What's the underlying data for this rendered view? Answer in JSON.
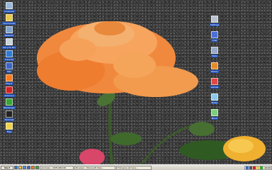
{
  "desktop": {
    "left_icons": [
      {
        "label": "Computer",
        "icon": "computer-icon",
        "color": "#9bb8d8"
      },
      {
        "label": "Documents",
        "icon": "folder-icon",
        "color": "#e9c94a"
      },
      {
        "label": "Network",
        "icon": "network-icon",
        "color": "#7fa3cf"
      },
      {
        "label": "Recycle Bin",
        "icon": "recycle-bin-icon",
        "color": "#c9d3da"
      },
      {
        "label": "Internet",
        "icon": "internet-icon",
        "color": "#2f7bd4"
      },
      {
        "label": "Mail",
        "icon": "mail-icon",
        "color": "#3b66c4"
      },
      {
        "label": "Player",
        "icon": "media-player-icon",
        "color": "#ff7a1a"
      },
      {
        "label": "Antivirus",
        "icon": "shield-icon",
        "color": "#d42020"
      },
      {
        "label": "Messenger",
        "icon": "messenger-icon",
        "color": "#36a536"
      },
      {
        "label": "Terminal",
        "icon": "terminal-icon",
        "color": "#232323"
      },
      {
        "label": "Files",
        "icon": "folder-icon",
        "color": "#f0d24a"
      }
    ],
    "right_icons": [
      {
        "label": "Settings",
        "icon": "gear-icon",
        "color": "#b9c3cf"
      },
      {
        "label": "Chat",
        "icon": "chat-icon",
        "color": "#4c6fd6"
      },
      {
        "label": "Tools",
        "icon": "tools-icon",
        "color": "#9aa9c6"
      },
      {
        "label": "Photos",
        "icon": "photo-icon",
        "color": "#e38b2b"
      },
      {
        "label": "Games",
        "icon": "game-icon",
        "color": "#e04848"
      },
      {
        "label": "Notes",
        "icon": "notes-icon",
        "color": "#8ec6e9"
      },
      {
        "label": "Music",
        "icon": "music-icon",
        "color": "#7ccf7c"
      }
    ]
  },
  "taskbar": {
    "start_label": "Start",
    "quick_launch": [
      {
        "icon": "browser-icon",
        "color": "#2f7bd4"
      },
      {
        "icon": "folder-icon",
        "color": "#e9c94a"
      },
      {
        "icon": "desktop-icon",
        "color": "#5a8bd6"
      },
      {
        "icon": "mail-icon",
        "color": "#3b66c4"
      },
      {
        "icon": "media-player-icon",
        "color": "#ff7a1a"
      },
      {
        "icon": "chat-icon",
        "color": "#36a536"
      }
    ],
    "tasks": [
      {
        "label": "windows - 3WFL0BOON"
      },
      {
        "label": "Browser - Microsoft Inter..."
      },
      {
        "label": "Fotoserie ist here..."
      }
    ],
    "tray_icons": [
      {
        "icon": "network-icon",
        "color": "#3b66c4"
      },
      {
        "icon": "volume-icon",
        "color": "#555555"
      },
      {
        "icon": "shield-icon",
        "color": "#d42020"
      },
      {
        "icon": "update-icon",
        "color": "#e9c94a"
      },
      {
        "icon": "messenger-icon",
        "color": "#36a536"
      }
    ],
    "clock": "18:08"
  }
}
